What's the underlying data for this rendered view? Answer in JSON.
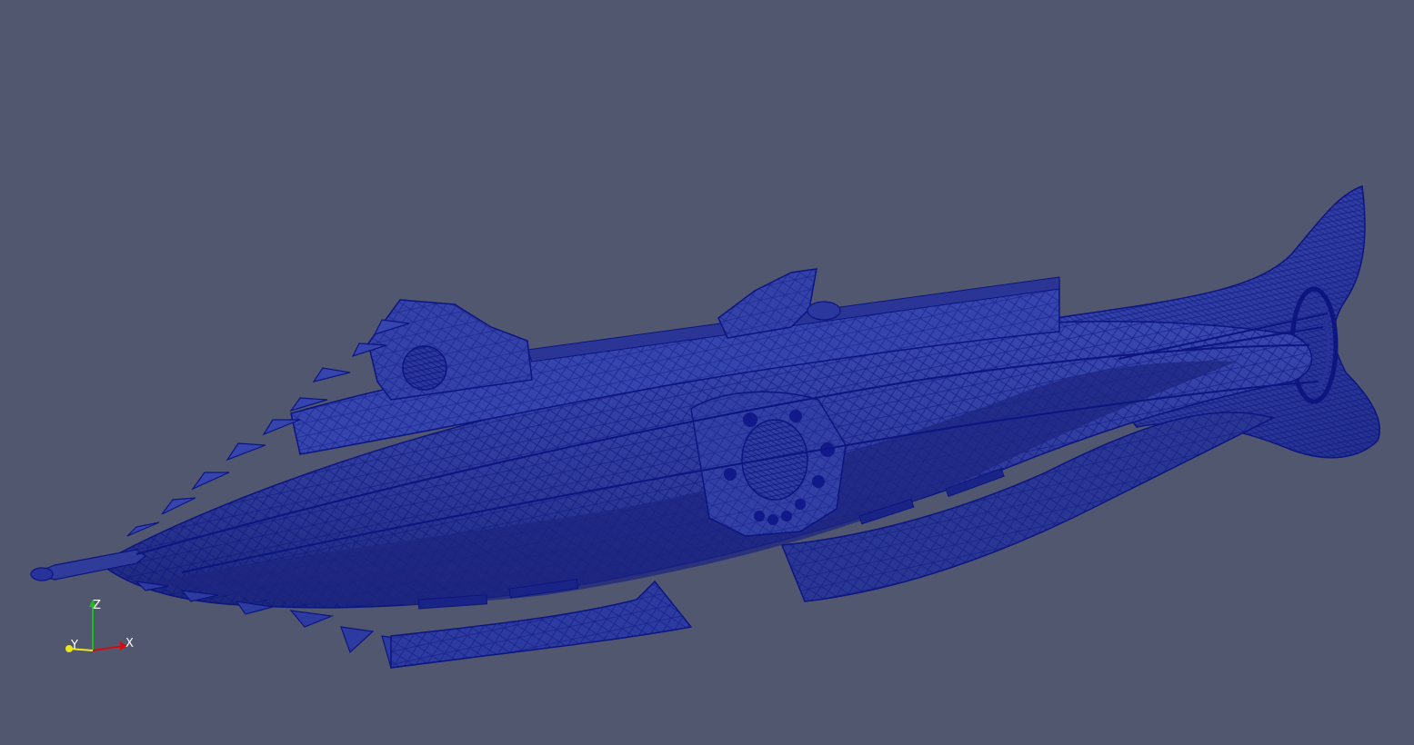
{
  "viewport": {
    "background": "#525770",
    "model": {
      "name": "submarine-mesh",
      "representation": "surface-with-edges",
      "surface_color": "#2f3c9a",
      "edge_color": "#0c1580",
      "shade_light": "#3947b0",
      "shade_dark": "#1e2a82"
    },
    "orientation_axes": {
      "x_label": "X",
      "y_label": "Y",
      "z_label": "Z",
      "x_color": "#d01010",
      "y_color": "#e8e81a",
      "z_color": "#18c018"
    }
  }
}
